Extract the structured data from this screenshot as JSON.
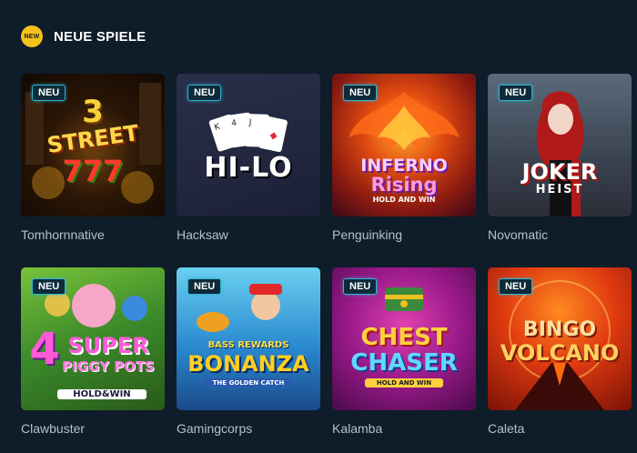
{
  "header": {
    "badge_label": "NEW",
    "title": "NEUE SPIELE"
  },
  "games": [
    {
      "provider": "Tomhornnative",
      "badge": "NEU",
      "art_lines": [
        "3",
        "STREET",
        "777"
      ]
    },
    {
      "provider": "Hacksaw",
      "badge": "NEU",
      "art_lines": [
        "HI-LO"
      ]
    },
    {
      "provider": "Penguinking",
      "badge": "NEU",
      "art_lines": [
        "INFERNO",
        "Rising",
        "HOLD AND WIN"
      ]
    },
    {
      "provider": "Novomatic",
      "badge": "NEU",
      "art_lines": [
        "JOKER",
        "HEIST"
      ]
    },
    {
      "provider": "Clawbuster",
      "badge": "NEU",
      "art_lines": [
        "4",
        "SUPER",
        "PIGGY POTS",
        "HOLD&WIN"
      ]
    },
    {
      "provider": "Gamingcorps",
      "badge": "NEU",
      "art_lines": [
        "BASS REWARDS",
        "BONANZA",
        "THE GOLDEN CATCH"
      ]
    },
    {
      "provider": "Kalamba",
      "badge": "NEU",
      "art_lines": [
        "CHEST",
        "CHASER",
        "HOLD AND WIN"
      ]
    },
    {
      "provider": "Caleta",
      "badge": "NEU",
      "art_lines": [
        "BINGO",
        "VOLCANO"
      ]
    }
  ],
  "colors": {
    "background": "#0f1c29",
    "badge_yellow": "#f6c21a",
    "neu_border": "#2fb6d3"
  }
}
